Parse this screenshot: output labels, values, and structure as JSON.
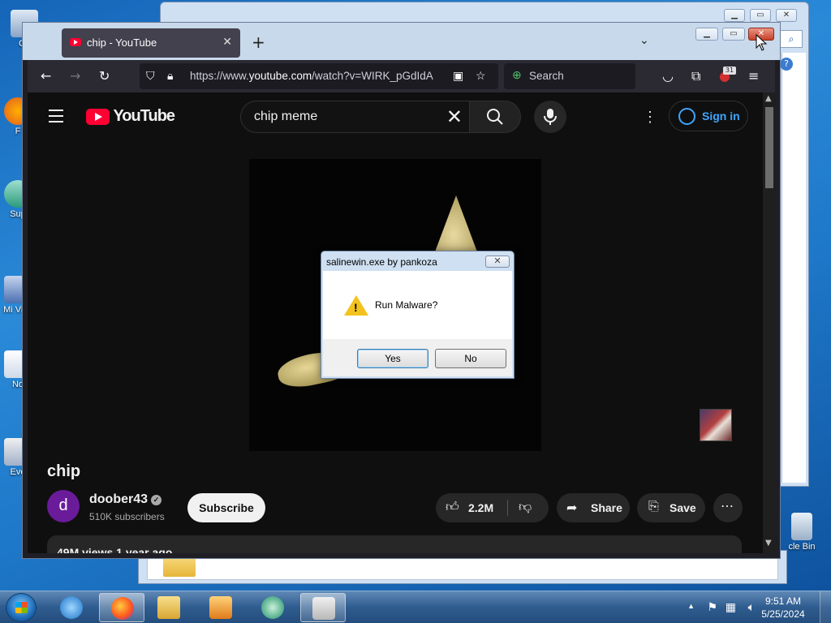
{
  "desktop": {
    "icons": [
      {
        "label": "Co"
      },
      {
        "label": "F"
      },
      {
        "label": "Sup"
      },
      {
        "label": "Mi Visu"
      },
      {
        "label": "No"
      },
      {
        "label": "Eve"
      },
      {
        "label": "cle Bin"
      }
    ]
  },
  "browser": {
    "tab_title": "chip - YouTube",
    "tab_close": "✕",
    "new_tab": "+",
    "tab_list": "⌄",
    "url_host": "https://www.",
    "url_rest": "youtube.com",
    "url_path": "/watch?v=WIRK_pGdIdA",
    "search_placeholder": "Search",
    "notification_count": "31"
  },
  "youtube": {
    "logo_text": "YouTube",
    "search_query": "chip meme",
    "sign_in": "Sign in",
    "video_title": "chip",
    "channel_initial": "d",
    "channel_name": "doober43",
    "subscribers": "510K subscribers",
    "subscribe": "Subscribe",
    "likes": "2.2M",
    "share": "Share",
    "save": "Save",
    "views_line": "49M views  1 year ago"
  },
  "dialog": {
    "title": "salinewin.exe by pankoza",
    "message": "Run Malware?",
    "yes": "Yes",
    "no": "No"
  },
  "taskbar": {
    "time": "9:51 AM",
    "date": "5/25/2024"
  },
  "colors": {
    "youtube_red": "#ff0033",
    "link_blue": "#3ea6ff",
    "channel_avatar": "#6a1b9a"
  }
}
